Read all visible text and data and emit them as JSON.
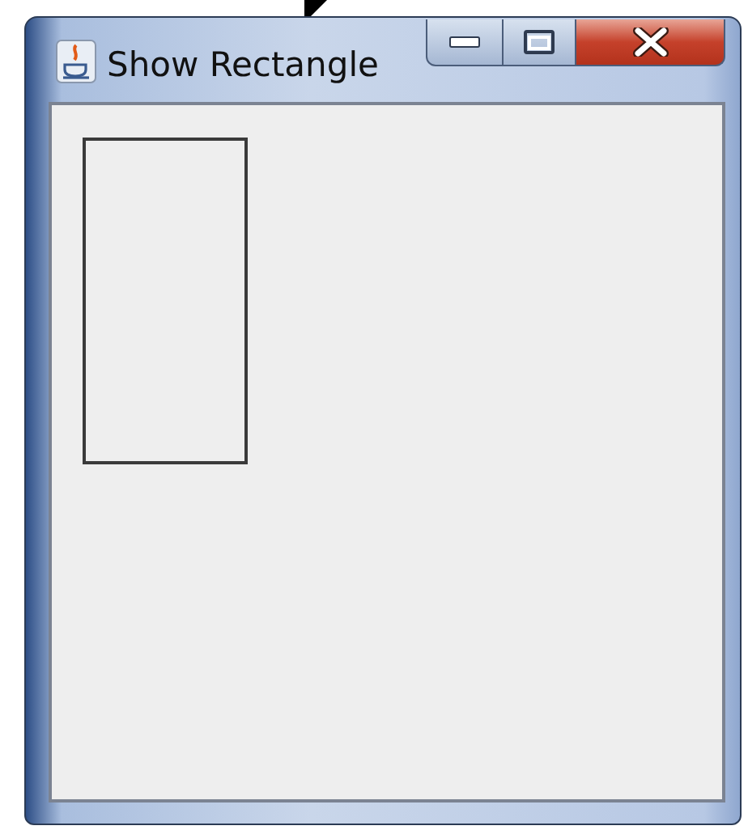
{
  "window": {
    "title": "Show Rectangle"
  }
}
